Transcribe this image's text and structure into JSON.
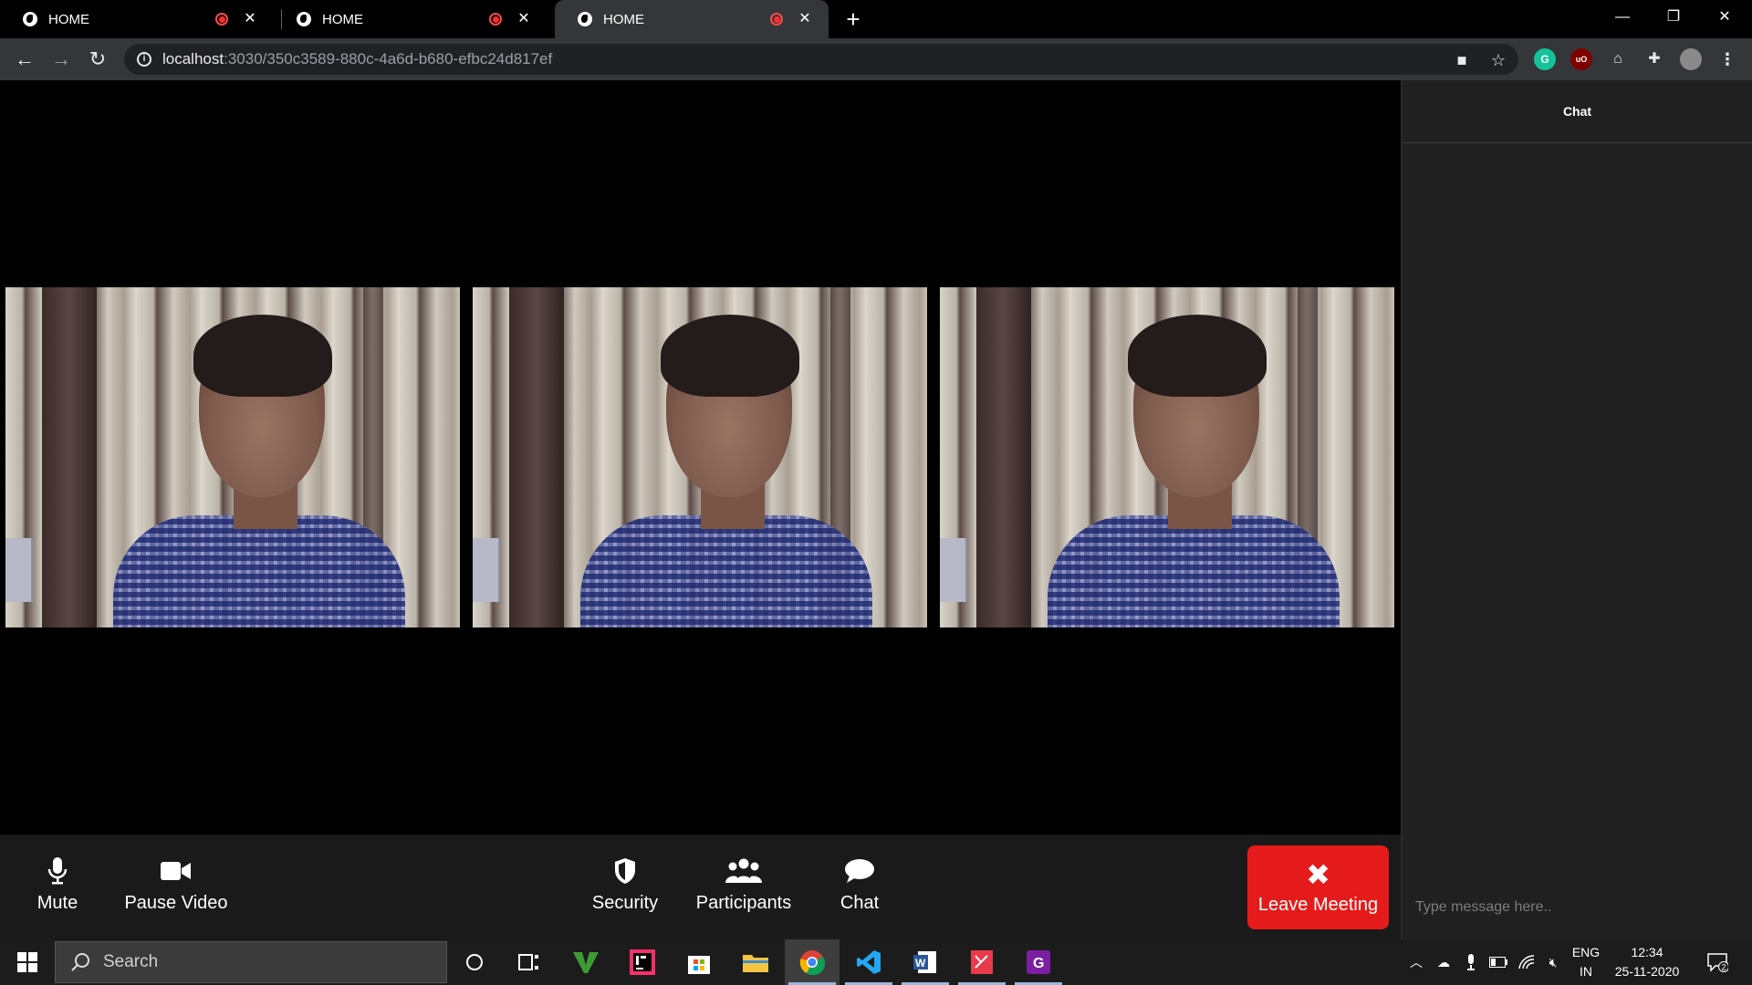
{
  "browser": {
    "tabs": [
      {
        "title": "HOME"
      },
      {
        "title": "HOME"
      },
      {
        "title": "HOME"
      }
    ],
    "url_host": "localhost",
    "url_path": ":3030/350c3589-880c-4a6d-b680-efbc24d817ef"
  },
  "meeting": {
    "participants_videos": 3,
    "controls": {
      "mute_label": "Mute",
      "pause_video_label": "Pause Video",
      "security_label": "Security",
      "participants_label": "Participants",
      "chat_label": "Chat",
      "leave_label": "Leave Meeting"
    },
    "chat": {
      "title": "Chat",
      "placeholder": "Type message here.."
    }
  },
  "taskbar": {
    "search_placeholder": "Search",
    "lang_line1": "ENG",
    "lang_line2": "IN",
    "time": "12:34",
    "date": "25-11-2020",
    "notification_count": "2"
  },
  "colors": {
    "leave_button": "#e51b1b",
    "chat_panel_bg": "#202020",
    "controls_bg": "#1a1a1a"
  }
}
